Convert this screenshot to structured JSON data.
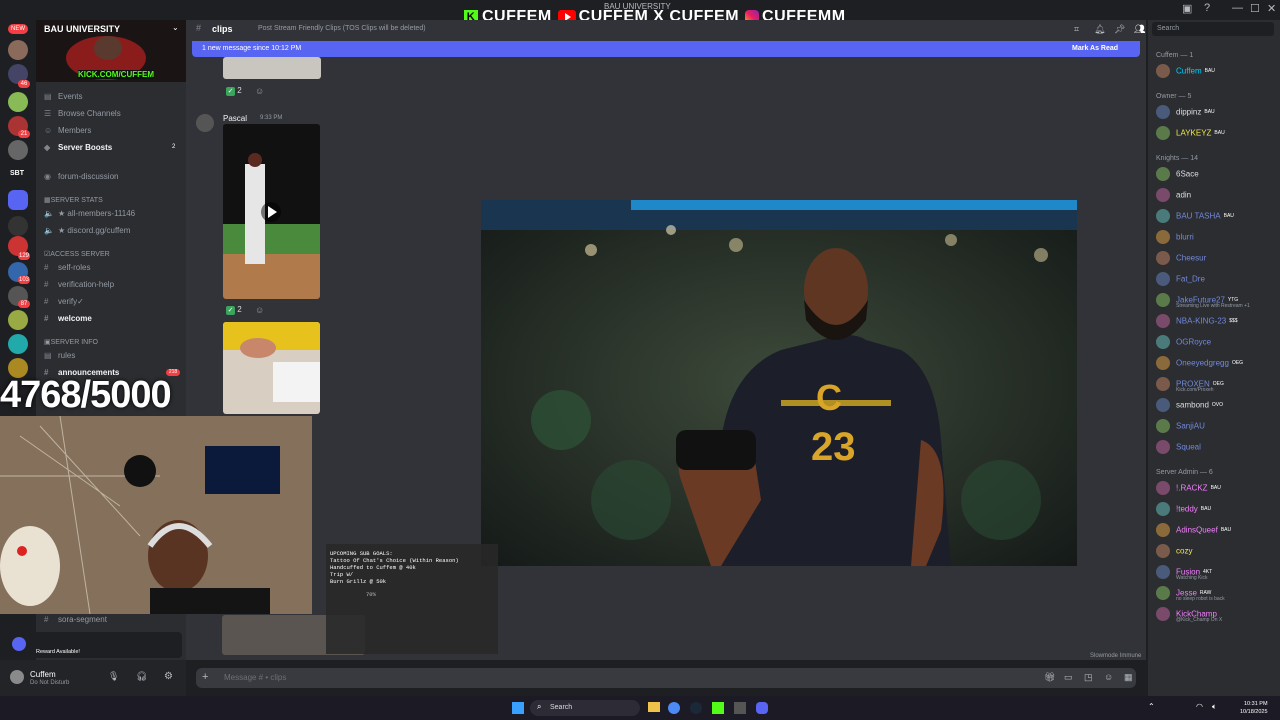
{
  "stream_banner": {
    "brand_k": "CUFFEM",
    "brand_yt": "CUFFEM",
    "brand_x": "X",
    "brand_x_name": "CUFFEM",
    "brand_ig": "CUFFEMM",
    "top_server_label": "BAU UNIVERSITY"
  },
  "server": {
    "name": "BAU UNIVERSITY",
    "kick_banner": "KICK.COM/CUFFEM",
    "rail_badges": [
      "NEW",
      "46",
      "21",
      "129",
      "103",
      "87"
    ],
    "rail_label": "SBT",
    "nav": [
      {
        "label": "Events"
      },
      {
        "label": "Browse Channels"
      },
      {
        "label": "Members"
      },
      {
        "label": "Server Boosts",
        "count": "2"
      }
    ],
    "channels": [
      {
        "label": "forum-discussion"
      },
      {
        "label": "SERVER STATS",
        "category": true
      },
      {
        "label": "★ all-members-11146"
      },
      {
        "label": "★ discord.gg/cuffem"
      },
      {
        "label": "Access Server",
        "category": true
      },
      {
        "label": "self-roles"
      },
      {
        "label": "verification-help"
      },
      {
        "label": "verify✓"
      },
      {
        "label": "welcome",
        "bright": true
      },
      {
        "label": "Server Info",
        "category": true
      },
      {
        "label": "rules"
      },
      {
        "label": "announcements",
        "bright": true,
        "badge": "218"
      },
      {
        "label": "sora-segment"
      }
    ]
  },
  "channel_header": {
    "name": "clips",
    "topic": "Post Stream Friendly Clips (TOS Clips will be deleted)"
  },
  "new_message_bar": {
    "text": "1 new message since 10:12 PM",
    "action": "Mark As Read"
  },
  "messages": {
    "reaction_count_1": "2",
    "reaction_count_2": "2",
    "author": "Pascal",
    "timestamp": "9:33 PM"
  },
  "composer": {
    "placeholder": "Message # • clips",
    "slowmode": "Slowmode Immune"
  },
  "user_panel": {
    "name": "Cuffem",
    "status": "Do Not Disturb",
    "reward": "Reward Available!"
  },
  "member_list": {
    "search_placeholder": "Search",
    "groups": [
      {
        "title": "Cuffem — 1",
        "members": [
          {
            "name": "Cuffem",
            "tag": "BAU",
            "color": "#00d1ff"
          }
        ]
      },
      {
        "title": "Owner — 5",
        "members": [
          {
            "name": "dippinz",
            "tag": "BAU",
            "color": "#dbdee1"
          },
          {
            "name": "LAYKEYZ",
            "tag": "BAU",
            "color": "#f0e84b"
          }
        ]
      },
      {
        "title": "Knights — 14",
        "members": [
          {
            "name": "6Sace",
            "color": "#dbdee1"
          },
          {
            "name": "adin",
            "color": "#dbdee1"
          },
          {
            "name": "BAU TASHA",
            "tag": "BAU",
            "color": "#7289da"
          },
          {
            "name": "blurri",
            "color": "#7289da"
          },
          {
            "name": "Cheesur",
            "color": "#7289da"
          },
          {
            "name": "Fat_Dre",
            "color": "#7289da"
          },
          {
            "name": "JakeFuture27",
            "tag": "YTG",
            "sub": "Streaming Live with Restream +1",
            "color": "#7289da"
          },
          {
            "name": "NBA-KING-23",
            "tag": "$$$",
            "color": "#7289da"
          },
          {
            "name": "OGRoyce",
            "color": "#7289da"
          },
          {
            "name": "Oneeyedgregg",
            "tag": "OEG",
            "color": "#7289da"
          },
          {
            "name": "PROXEN",
            "tag": "OEG",
            "sub": "Kick.com/Proxeh",
            "color": "#7289da"
          },
          {
            "name": "sambond",
            "tag": "OVO",
            "color": "#dbdee1"
          },
          {
            "name": "SanjiAU",
            "color": "#7289da"
          },
          {
            "name": "Squeal",
            "color": "#7289da"
          }
        ]
      },
      {
        "title": "Server Admin — 6",
        "members": [
          {
            "name": "!.RACKZ",
            "tag": "BAU",
            "color": "#f47fff"
          },
          {
            "name": "!teddy",
            "tag": "BAU",
            "color": "#f47fff"
          },
          {
            "name": "AdinsQueef",
            "tag": "BAU",
            "color": "#f47fff"
          },
          {
            "name": "cozy",
            "color": "#f0e84b"
          },
          {
            "name": "Fusion",
            "tag": "4KT",
            "sub": "Watching Kick",
            "color": "#f47fff"
          },
          {
            "name": "Jesse",
            "tag": "RAW",
            "sub": "no sleep robot is back",
            "color": "#f47fff"
          },
          {
            "name": "KickChamp",
            "sub": "@Kick_Champ On X",
            "color": "#f47fff"
          }
        ]
      }
    ]
  },
  "overlay": {
    "sub_count": "4768/5000",
    "goals_title": "UPCOMING SUB GOALS:",
    "goals": [
      "Tattoo Of Chat's Choice (Within Reason)",
      "Handcuffed to Cuffem @ 40k",
      "Trip W/",
      "Burn Grillz @ 50k"
    ],
    "goal_pct": "70%"
  },
  "taskbar": {
    "search": "Search",
    "time": "10:31 PM",
    "date": "10/18/2025"
  },
  "colors": {
    "accent": "#5865f2",
    "bg": "#313338",
    "sidebar": "#2b2d31"
  }
}
